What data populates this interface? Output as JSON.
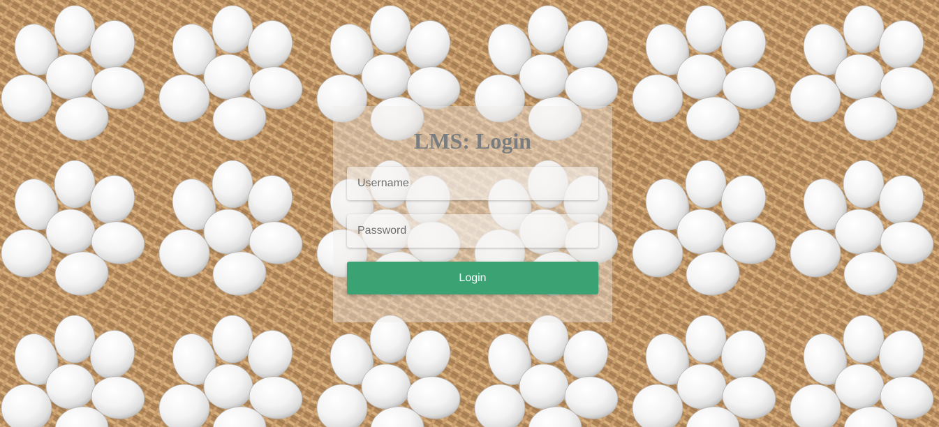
{
  "page": {
    "background": "egg-basket-tile-pattern",
    "accent_color": "#3ba274"
  },
  "login": {
    "title": "LMS: Login",
    "username_placeholder": "Username",
    "password_placeholder": "Password",
    "submit_label": "Login"
  }
}
